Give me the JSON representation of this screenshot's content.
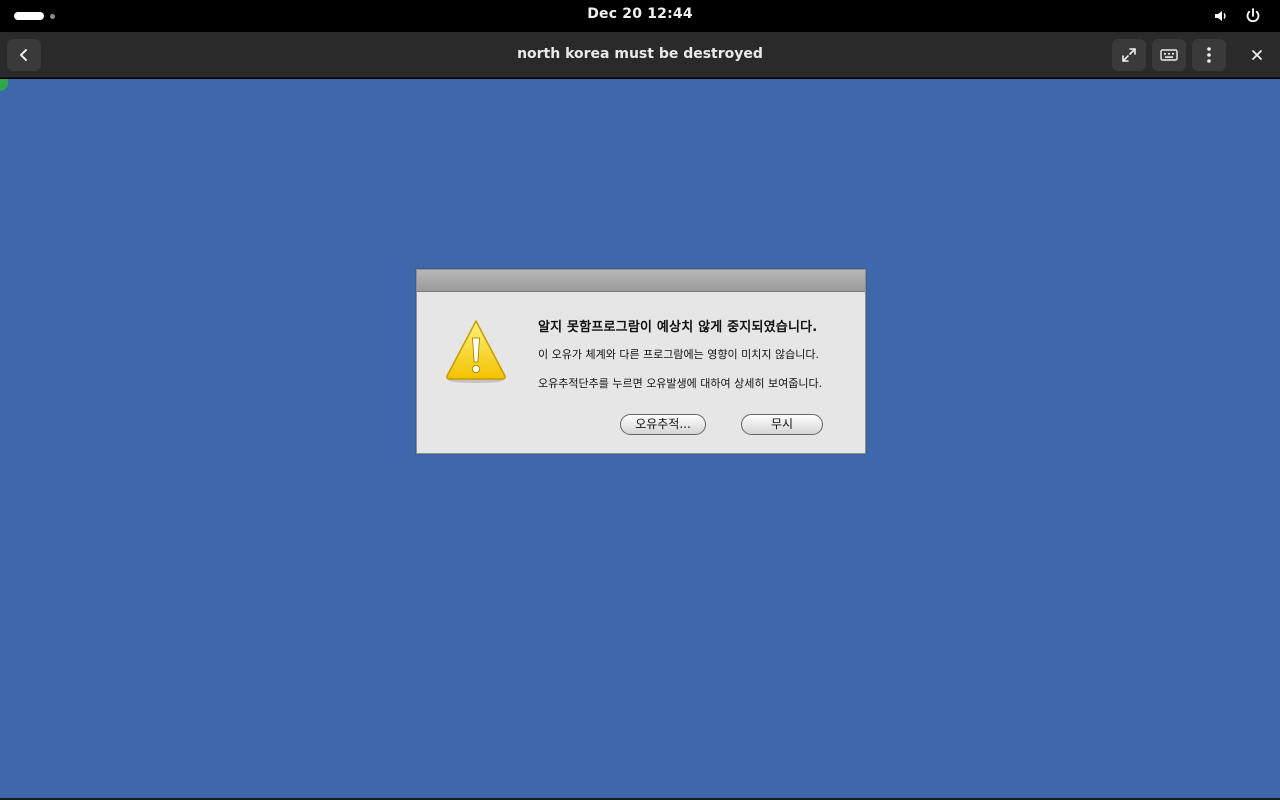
{
  "topbar": {
    "clock": "Dec 20  12:44",
    "icons": [
      "activities-indicator",
      "volume-icon",
      "power-icon"
    ]
  },
  "headerbar": {
    "title": "north korea must be destroyed",
    "icons": [
      "back-arrow-icon",
      "fullscreen-icon",
      "keyboard-icon",
      "menu-dots-icon",
      "close-icon"
    ]
  },
  "desktop": {
    "background_color": "#3f68ab"
  },
  "dialog": {
    "icon": "warning-triangle-icon",
    "heading": "알지 못함프로그람이 예상치 않게 중지되였습니다.",
    "line1": "이 오유가 체계와 다른 프로그람에는 영향이 미치지 않습니다.",
    "line2": "오유추적단추를 누르면 오유발생에 대하여 상세히 보여줍니다.",
    "button_trace": "오유추적...",
    "button_ignore": "무시"
  }
}
